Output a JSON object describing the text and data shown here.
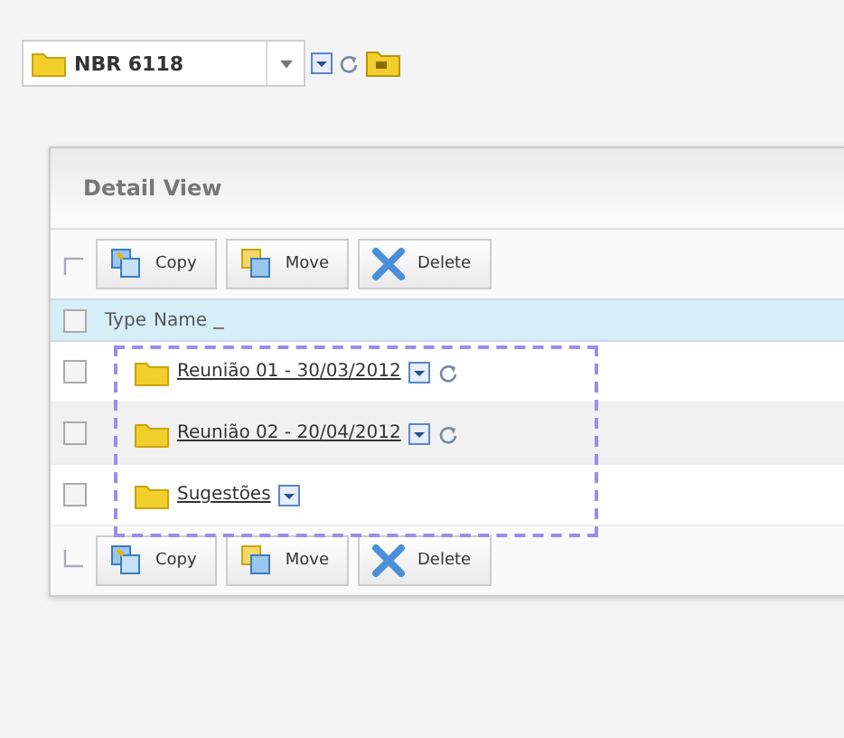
{
  "folder_picker": {
    "value": "NBR 6118"
  },
  "panel": {
    "title": "Detail View"
  },
  "toolbars": [
    {
      "kind": "top",
      "buttons": [
        {
          "kind": "copy",
          "label": "Copy"
        },
        {
          "kind": "move",
          "label": "Move"
        },
        {
          "kind": "delete",
          "label": "Delete"
        }
      ]
    },
    {
      "kind": "bottom",
      "buttons": [
        {
          "kind": "copy",
          "label": "Copy"
        },
        {
          "kind": "move",
          "label": "Move"
        },
        {
          "kind": "delete",
          "label": "Delete"
        }
      ]
    }
  ],
  "table": {
    "select_all_checked": false,
    "columns": [
      "Type",
      "Name"
    ],
    "rows": [
      {
        "name": "Reunião 01 - 30/03/2012",
        "checked": false,
        "refresh": true
      },
      {
        "name": "Reunião 02 - 20/04/2012",
        "checked": false,
        "refresh": true
      },
      {
        "name": "Sugestões",
        "checked": false,
        "refresh": false
      }
    ]
  }
}
